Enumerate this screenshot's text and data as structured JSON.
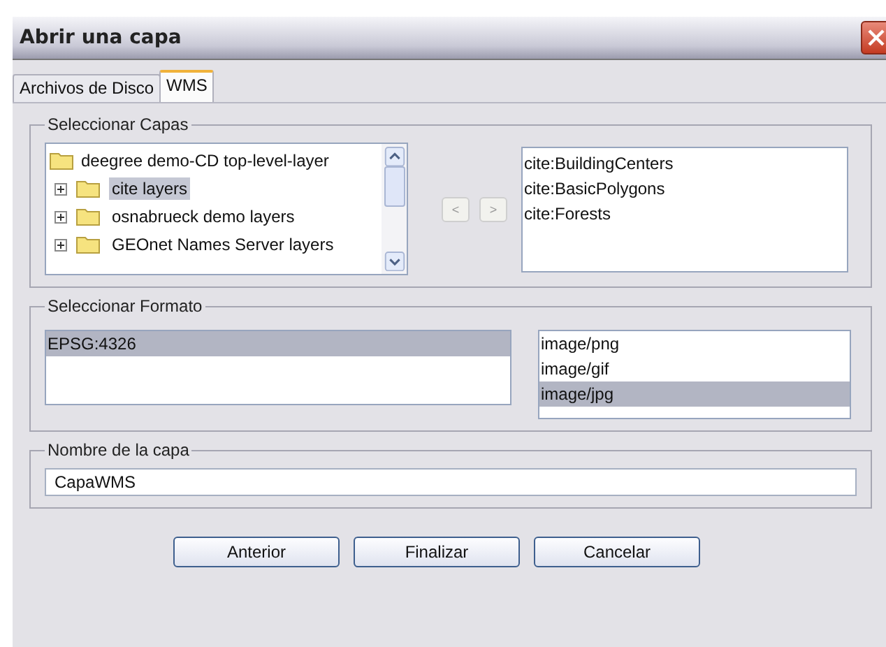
{
  "window": {
    "title": "Abrir una capa"
  },
  "tabs": [
    {
      "label": "Archivos de Disco",
      "selected": false
    },
    {
      "label": "WMS",
      "selected": true
    }
  ],
  "layers_group": {
    "title": "Seleccionar Capas",
    "tree": [
      {
        "label": "deegree demo-CD top-level-layer",
        "selected": false,
        "children": [
          {
            "label": "cite layers",
            "selected": true,
            "expanded": false
          },
          {
            "label": "osnabrueck demo layers",
            "selected": false,
            "expanded": false
          },
          {
            "label": "GEOnet Names Server layers",
            "selected": false,
            "expanded": false
          }
        ]
      }
    ],
    "move_buttons": [
      "<",
      ">"
    ],
    "selected_layers": [
      "cite:BuildingCenters",
      "cite:BasicPolygons",
      "cite:Forests"
    ]
  },
  "format_group": {
    "title": "Seleccionar Formato",
    "crs": [
      {
        "label": "EPSG:4326",
        "selected": true
      }
    ],
    "formats": [
      {
        "label": "image/png",
        "selected": false
      },
      {
        "label": "image/gif",
        "selected": false
      },
      {
        "label": "image/jpg",
        "selected": true
      }
    ]
  },
  "name_group": {
    "title": "Nombre de la capa",
    "value": "CapaWMS"
  },
  "buttons": [
    "Anterior",
    "Finalizar",
    "Cancelar"
  ]
}
